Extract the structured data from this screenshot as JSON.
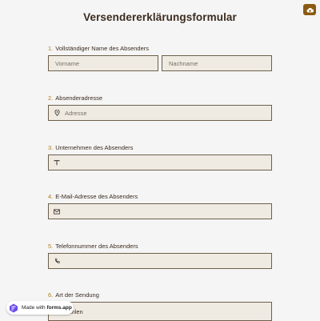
{
  "form": {
    "title": "Versendererklärungsformular",
    "save_icon": "cloud-save-icon",
    "accent_color": "#b07d1e",
    "button_color": "#8b5a12"
  },
  "fields": [
    {
      "number": "1.",
      "label": "Vollständiger Name des Absenders",
      "first_placeholder": "Vorname",
      "last_placeholder": "Nachname"
    },
    {
      "number": "2.",
      "label": "Absenderadresse",
      "placeholder": "Adresse",
      "icon": "location-pin-icon"
    },
    {
      "number": "3.",
      "label": "Unternehmen des Absenders",
      "placeholder": "",
      "icon": "text-icon"
    },
    {
      "number": "4.",
      "label": "E-Mail-Adresse des Absenders",
      "placeholder": "",
      "icon": "mail-icon"
    },
    {
      "number": "5.",
      "label": "Telefonnummer des Absenders",
      "placeholder": "",
      "icon": "phone-icon"
    },
    {
      "number": "6.",
      "label": "Art der Sendung",
      "selected": "Auswählen"
    }
  ],
  "badge": {
    "prefix": "Made with ",
    "brand": "forms.app",
    "logo_icon": "forms-app-logo-icon"
  }
}
